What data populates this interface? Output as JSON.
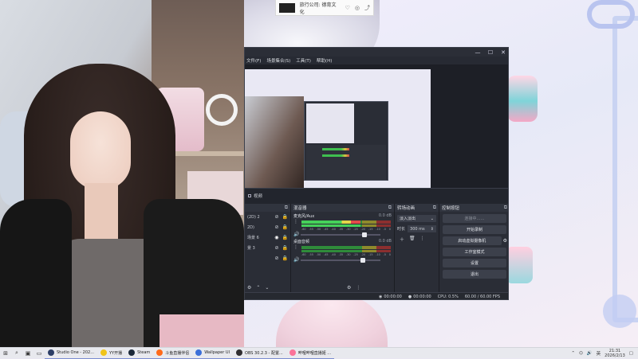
{
  "notification": {
    "text": "旅行公司: 德育文化"
  },
  "obs": {
    "window_controls": {
      "minimize": "—",
      "maximize": "☐",
      "close": "✕"
    },
    "menu": [
      "文件(F)",
      "场景集合(S)",
      "工具(T)",
      "帮助(H)"
    ],
    "source_label": "视频",
    "scenes": {
      "title": "",
      "items": [
        {
          "label": "(2D) 2",
          "active": false
        },
        {
          "label": "2D)",
          "active": false
        },
        {
          "label": "场景 6",
          "active": true
        },
        {
          "label": "景 3",
          "active": false
        },
        {
          "label": "",
          "active": false
        }
      ]
    },
    "mixer": {
      "title": "混音器",
      "channels": [
        {
          "name": "麦克风/Aux",
          "db": "0.0 dB",
          "level": 0.66,
          "volume": 0.8
        },
        {
          "name": "桌面音频",
          "db": "0.0 dB",
          "level": 0.0,
          "volume": 0.78
        }
      ],
      "ticks": [
        "-60",
        "-55",
        "-50",
        "-45",
        "-40",
        "-35",
        "-30",
        "-25",
        "-20",
        "-15",
        "-10",
        "-5",
        "0"
      ]
    },
    "transitions": {
      "title": "转场动画",
      "selected": "淡入淡出",
      "duration_label": "时长",
      "duration_value": "300 ms"
    },
    "controls": {
      "title": "控制按钮",
      "buttons": [
        "连接中……",
        "开始录制",
        "启动虚拟摄像机",
        "工作室模式",
        "设置",
        "退出"
      ]
    },
    "status": {
      "stream_time": "00:00:00",
      "rec_time": "00:00:00",
      "cpu": "CPU: 0.5%",
      "fps": "60.00 / 60.00 FPS"
    }
  },
  "taskbar": {
    "apps": [
      {
        "label": "Studio One - 202...",
        "color": "#2c3e66"
      },
      {
        "label": "YY开播",
        "color": "#f0c419"
      },
      {
        "label": "Steam",
        "color": "#1b2838"
      },
      {
        "label": "斗鱼直播伴侣",
        "color": "#ff6a1a"
      },
      {
        "label": "Wallpaper UI",
        "color": "#3b6fd8"
      },
      {
        "label": "OBS 30.2.3 - 配置...",
        "color": "#302e31"
      },
      {
        "label": "哔哩哔哩直播姬 ...",
        "color": "#fb7299"
      }
    ],
    "tray": {
      "lang": "英",
      "time": "21:31",
      "date": "2026/2/13"
    }
  },
  "colors": {
    "obs_bg": "#272a33",
    "meter_green": "#45d15a",
    "taskbar_bg": "#e8e9ee"
  }
}
